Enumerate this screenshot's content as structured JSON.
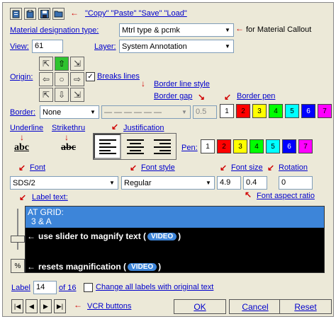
{
  "toolbar": {
    "icons": [
      "copy-icon",
      "paste-icon",
      "save-icon",
      "load-icon"
    ],
    "note": "\"Copy\" \"Paste\" \"Save\" \"Load\""
  },
  "material": {
    "label": "Material designation type:",
    "value": "Mtrl type & pcmk",
    "note": "for Material Callout"
  },
  "view": {
    "label": "View:",
    "value": "61"
  },
  "layer": {
    "label": "Layer:",
    "value": "System Annotation"
  },
  "origin": {
    "label": "Origin:",
    "buttons": [
      "⇱",
      "⇧",
      "⇲",
      "⇦",
      "○",
      "⇨",
      "⇱",
      "⇩",
      "⇲"
    ],
    "selected_index": 1
  },
  "breaks_lines": {
    "label": "Breaks lines",
    "checked": true
  },
  "border": {
    "label": "Border:",
    "value": "None",
    "line_style_label": "Border line style",
    "gap_label": "Border gap",
    "gap_value": "0.5",
    "pen_label": "Border pen",
    "pens": [
      "1",
      "2",
      "3",
      "4",
      "5",
      "6",
      "7"
    ]
  },
  "underline": {
    "label": "Underline",
    "sample": "abc"
  },
  "strikethru": {
    "label": "Strikethru",
    "sample": "abc"
  },
  "justification": {
    "label": "Justification"
  },
  "pen": {
    "label": "Pen:",
    "pens": [
      "1",
      "2",
      "3",
      "4",
      "5",
      "6",
      "7"
    ]
  },
  "font": {
    "label": "Font",
    "value": "SDS/2"
  },
  "font_style": {
    "label": "Font style",
    "value": "Regular"
  },
  "font_size": {
    "label": "Font size",
    "value": "4.9"
  },
  "aspect": {
    "value": "0.4",
    "label": "Font aspect ratio"
  },
  "rotation": {
    "label": "Rotation",
    "value": "0"
  },
  "label_text": {
    "label": "Label text:",
    "line1": "AT GRID:",
    "line2": "3 & A"
  },
  "hints": {
    "slider": "use slider to magnify text (",
    "reset": "resets magnification (",
    "video": "VIDEO",
    "close": ")"
  },
  "percent_button": "%",
  "label_nav": {
    "label": "Label",
    "value": "14",
    "of": "of 16",
    "change_all": "Change all labels with original text"
  },
  "vcr": {
    "note": "VCR buttons",
    "buttons": [
      "|◀",
      "◀",
      "▶",
      "▶|"
    ]
  },
  "buttons": {
    "ok": "OK",
    "cancel": "Cancel",
    "reset": "Reset"
  },
  "pen_colors": [
    "#ffffff",
    "#ff0000",
    "#ffff00",
    "#00ff00",
    "#00ffff",
    "#0000ff",
    "#ff00ff"
  ]
}
